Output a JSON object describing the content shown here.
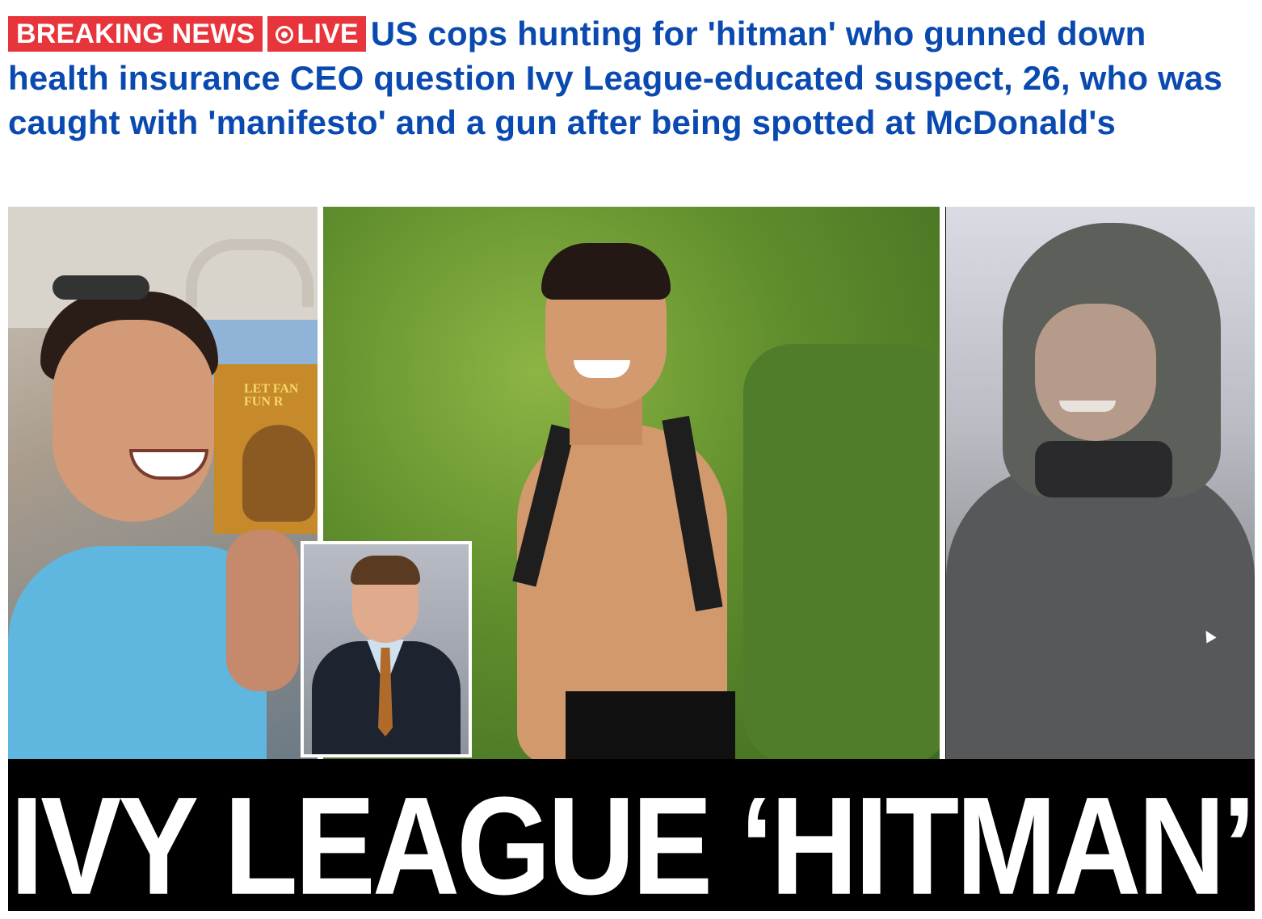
{
  "article": {
    "breaking_label": "BREAKING NEWS",
    "live_label": "LIVE",
    "headline": "US cops hunting for 'hitman' who gunned down health insurance CEO question Ivy League-educated suspect, 26, who was caught with 'manifesto' and a gun after being spotted at McDonald's"
  },
  "hero": {
    "box_text": "LET FAN\nFUN R",
    "banner_text": "IVY LEAGUE ‘HITMAN’"
  },
  "colors": {
    "headline_blue": "#0a4ab0",
    "badge_red": "#e8343b",
    "banner_bg": "#000000",
    "banner_text": "#ffffff"
  },
  "icons": {
    "live": "live-dot-icon",
    "cursor": "cursor-icon"
  }
}
